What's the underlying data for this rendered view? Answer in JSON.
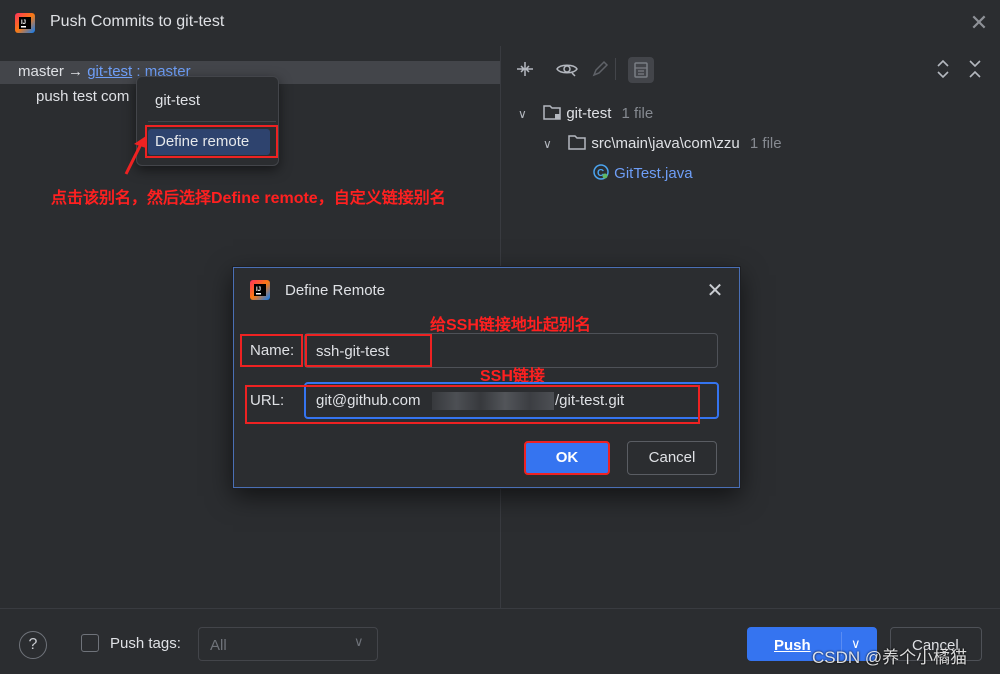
{
  "window": {
    "title": "Push Commits to git-test",
    "close_glyph": "✕"
  },
  "left": {
    "branch_local": "master",
    "arrow": "→",
    "remote_alias": "git-test",
    "sep": ":",
    "branch_remote": "master",
    "commit_message": "push test com"
  },
  "popup": {
    "item_remote": "git-test",
    "item_define": "Define remote"
  },
  "annotations": {
    "step1": "点击该别名，然后选择Define remote，自定义链接别名",
    "name_hint": "给SSH链接地址起别名",
    "url_hint": "SSH链接"
  },
  "tree": {
    "root_name": "git-test",
    "root_count": "1 file",
    "dir_name": "src\\main\\java\\com\\zzu",
    "dir_count": "1 file",
    "file_name": "GitTest.java"
  },
  "dialog": {
    "title": "Define Remote",
    "name_label": "Name:",
    "name_value": "ssh-git-test",
    "url_label": "URL:",
    "url_prefix": "git@github.com",
    "url_suffix": "/git-test.git",
    "ok_label": "OK",
    "cancel_label": "Cancel"
  },
  "bottom": {
    "help_glyph": "?",
    "push_tags_label": "Push tags:",
    "tags_value": "All",
    "push_label": "Push",
    "cancel_label": "Cancel"
  },
  "watermark": "CSDN @养个小橘猫",
  "colors": {
    "accent": "#3574f0",
    "link": "#6e9ef7",
    "annotation": "#ff2020"
  }
}
